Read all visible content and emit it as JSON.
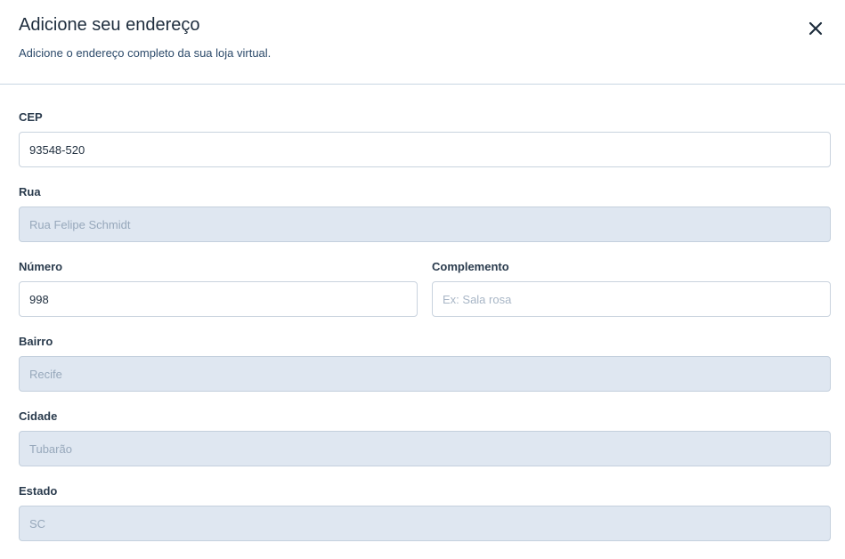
{
  "modal": {
    "title": "Adicione seu endereço",
    "subtitle": "Adicione o endereço completo da sua loja virtual.",
    "close_icon": "close-icon"
  },
  "form": {
    "cep": {
      "label": "CEP",
      "value": "93548-520"
    },
    "rua": {
      "label": "Rua",
      "value": "Rua Felipe Schmidt",
      "disabled": true
    },
    "numero": {
      "label": "Número",
      "value": "998"
    },
    "complemento": {
      "label": "Complemento",
      "value": "",
      "placeholder": "Ex: Sala rosa"
    },
    "bairro": {
      "label": "Bairro",
      "value": "Recife",
      "disabled": true
    },
    "cidade": {
      "label": "Cidade",
      "value": "Tubarão",
      "disabled": true
    },
    "estado": {
      "label": "Estado",
      "value": "SC",
      "disabled": true
    }
  },
  "colors": {
    "title": "#1e2d3d",
    "divider": "#c9d6e3",
    "disabled_bg": "#dfe7f1",
    "disabled_text": "#97a8bb"
  }
}
